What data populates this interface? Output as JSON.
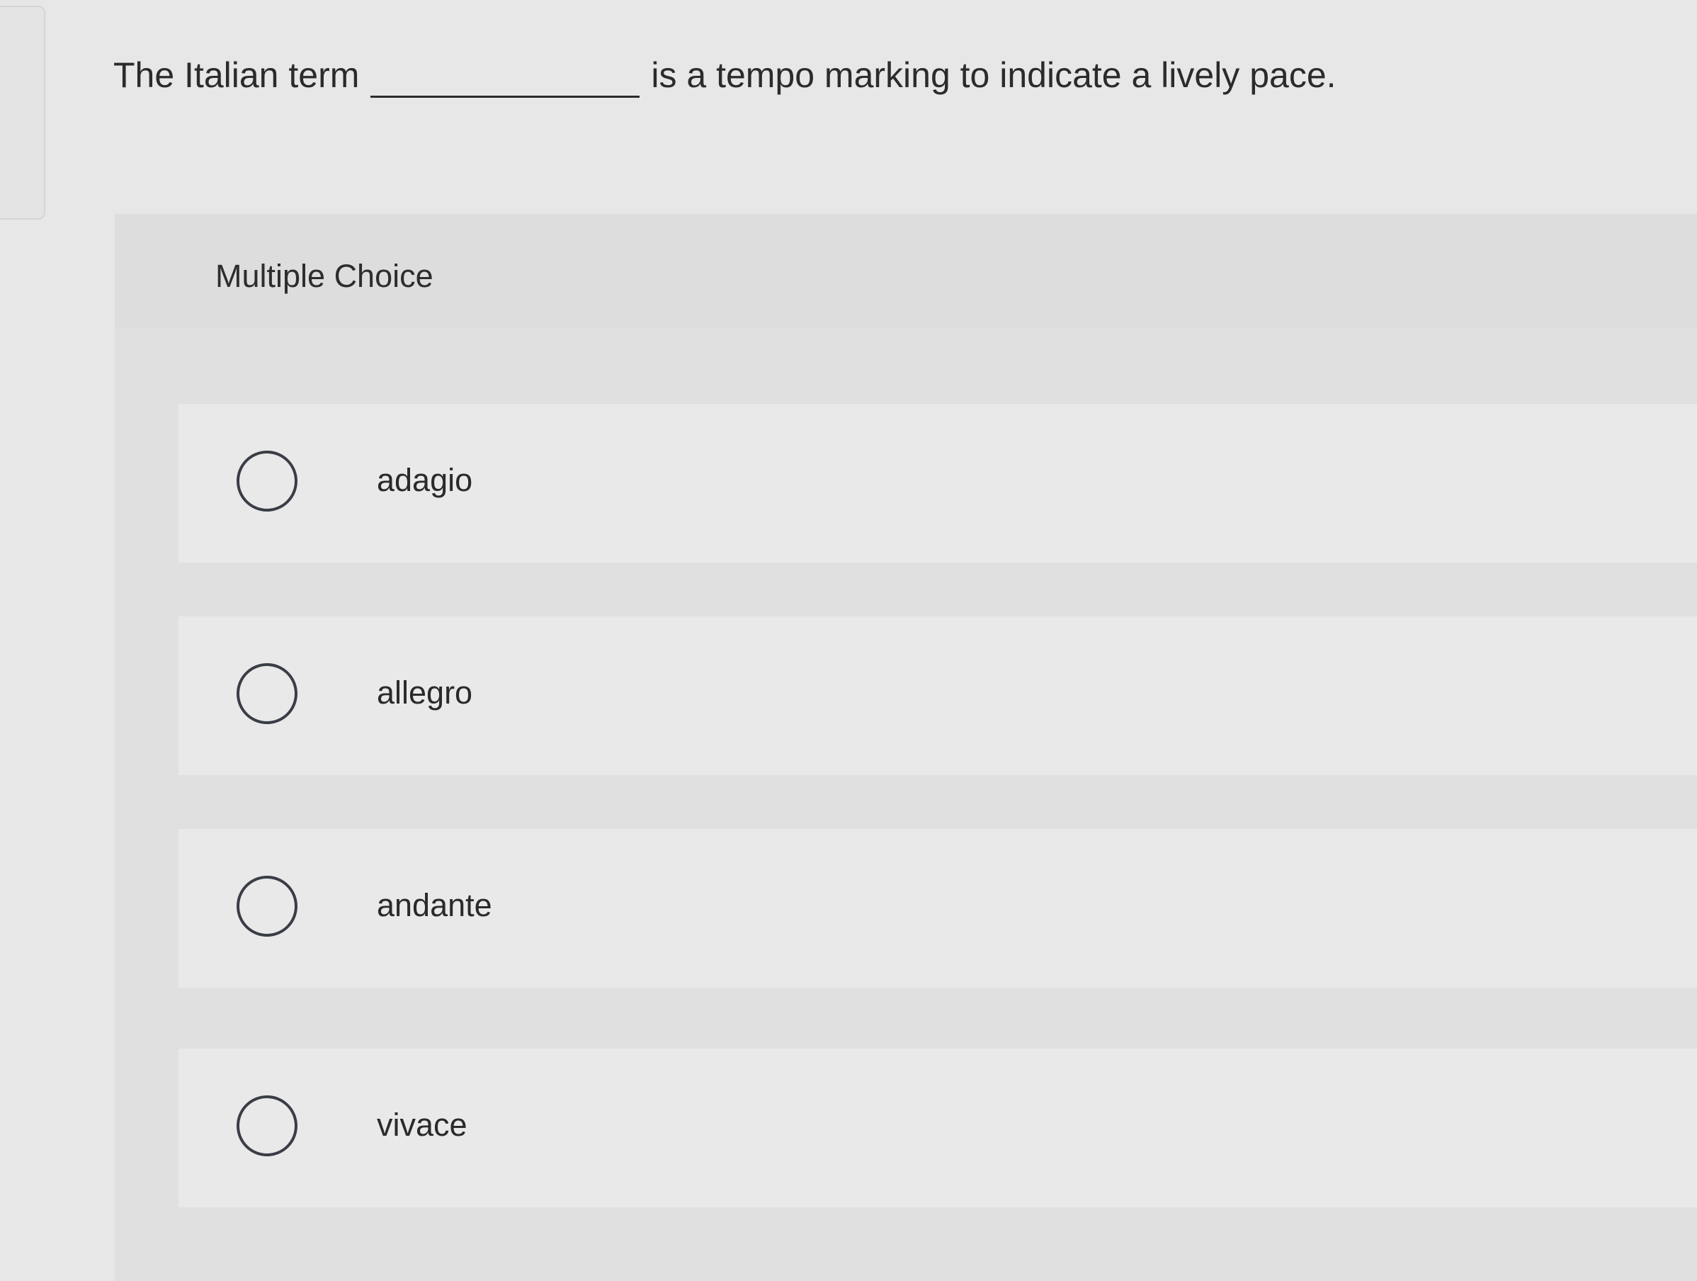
{
  "question": {
    "before": "The Italian term",
    "after": "is a tempo marking to indicate a lively pace."
  },
  "panel": {
    "title": "Multiple Choice"
  },
  "options": [
    {
      "label": "adagio"
    },
    {
      "label": "allegro"
    },
    {
      "label": "andante"
    },
    {
      "label": "vivace"
    }
  ]
}
